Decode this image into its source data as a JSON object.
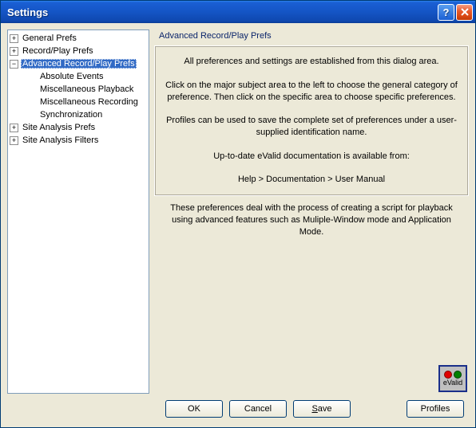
{
  "window": {
    "title": "Settings"
  },
  "tree": {
    "items": [
      {
        "label": "General Prefs",
        "level": 0,
        "toggle": "+",
        "selected": false
      },
      {
        "label": "Record/Play Prefs",
        "level": 0,
        "toggle": "+",
        "selected": false
      },
      {
        "label": "Advanced Record/Play Prefs",
        "level": 0,
        "toggle": "-",
        "selected": true
      },
      {
        "label": "Absolute Events",
        "level": 1,
        "toggle": "",
        "selected": false
      },
      {
        "label": "Miscellaneous Playback",
        "level": 1,
        "toggle": "",
        "selected": false
      },
      {
        "label": "Miscellaneous Recording",
        "level": 1,
        "toggle": "",
        "selected": false
      },
      {
        "label": "Synchronization",
        "level": 1,
        "toggle": "",
        "selected": false
      },
      {
        "label": "Site Analysis Prefs",
        "level": 0,
        "toggle": "+",
        "selected": false
      },
      {
        "label": "Site Analysis Filters",
        "level": 0,
        "toggle": "+",
        "selected": false
      }
    ]
  },
  "pane": {
    "title": "Advanced Record/Play Prefs",
    "intro_l1": "All preferences and settings are established from this dialog area.",
    "intro_l2": "Click on the major subject area to the left to choose the general category of preference.  Then click on the specific area to choose specific preferences.",
    "intro_l3": "Profiles can be used to save the complete set of preferences under a user-supplied identification name.",
    "intro_l4": "Up-to-date eValid documentation is available from:",
    "intro_l5": "Help > Documentation > User Manual",
    "desc": "These preferences deal with the process of creating a script for playback using advanced features such as Muliple-Window mode and Application Mode."
  },
  "logo": {
    "label": "eValid"
  },
  "buttons": {
    "ok": "OK",
    "cancel": "Cancel",
    "save_pre": "",
    "save_ul": "S",
    "save_post": "ave",
    "profiles": "Profiles"
  }
}
